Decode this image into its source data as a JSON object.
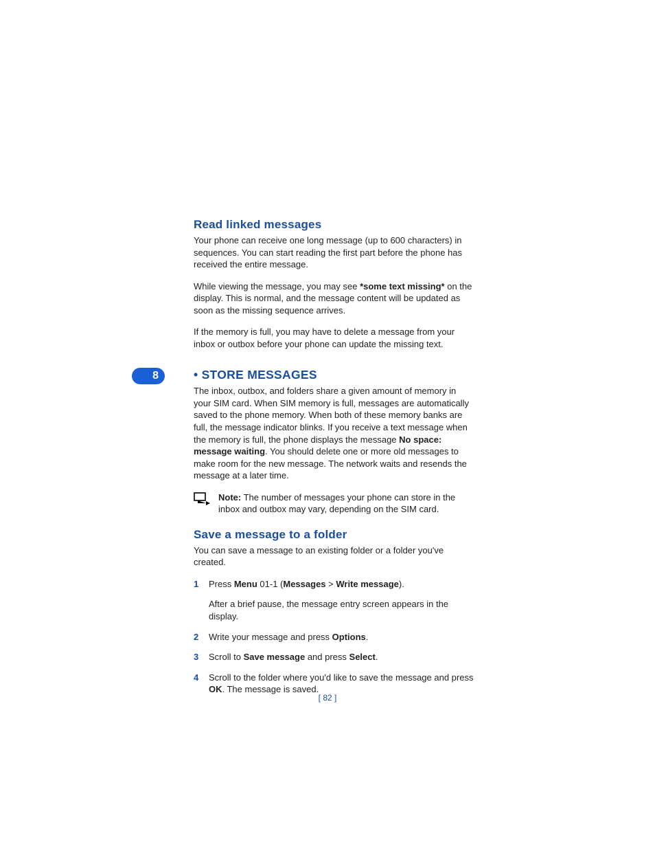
{
  "heading1": "Read linked messages",
  "h1_p1": "Your phone can receive one long message (up to 600 characters) in sequences. You can start reading the first part before the phone has received the entire message.",
  "h1_p2_a": "While viewing the message, you may see ",
  "h1_p2_bold": "*some text missing*",
  "h1_p2_b": " on the display. This is normal, and the message content will be updated as soon as the missing sequence arrives.",
  "h1_p3": "If the memory is full, you may have to delete a message from your inbox or outbox before your phone can update the missing text.",
  "sectionNumber": "8",
  "sectionBulletTitle": "•  STORE MESSAGES",
  "sec_p1_a": "The inbox, outbox, and folders share a given amount of memory in your SIM card. When SIM memory is full, messages are automatically saved to the phone memory. When both of these memory banks are full, the message indicator blinks. If you receive a text message when the memory is full, the phone displays the message ",
  "sec_p1_bold": "No space: message waiting",
  "sec_p1_b": ". You should delete one or more old messages to make room for the new message. The network waits and resends the message at a later time.",
  "note_label": "Note:",
  "note_text": " The number of messages your phone can store in the inbox and outbox may vary, depending on the SIM card.",
  "heading2": "Save a message to a folder",
  "h2_p1": "You can save a message to an existing folder or a folder you've created.",
  "step1_a": "Press ",
  "step1_b1": "Menu",
  "step1_c": " 01-1 (",
  "step1_b2": "Messages",
  "step1_d": " > ",
  "step1_b3": "Write message",
  "step1_e": ").",
  "step1_sub": "After a brief pause, the message entry screen appears in the display.",
  "step2_a": "Write your message and press ",
  "step2_b": "Options",
  "step2_c": ".",
  "step3_a": "Scroll to ",
  "step3_b1": "Save message",
  "step3_c": " and press ",
  "step3_b2": "Select",
  "step3_d": ".",
  "step4_a": "Scroll to the folder where you'd like to save the message and press ",
  "step4_b": "OK",
  "step4_c": ". The message is saved.",
  "pageNum": "[ 82 ]"
}
